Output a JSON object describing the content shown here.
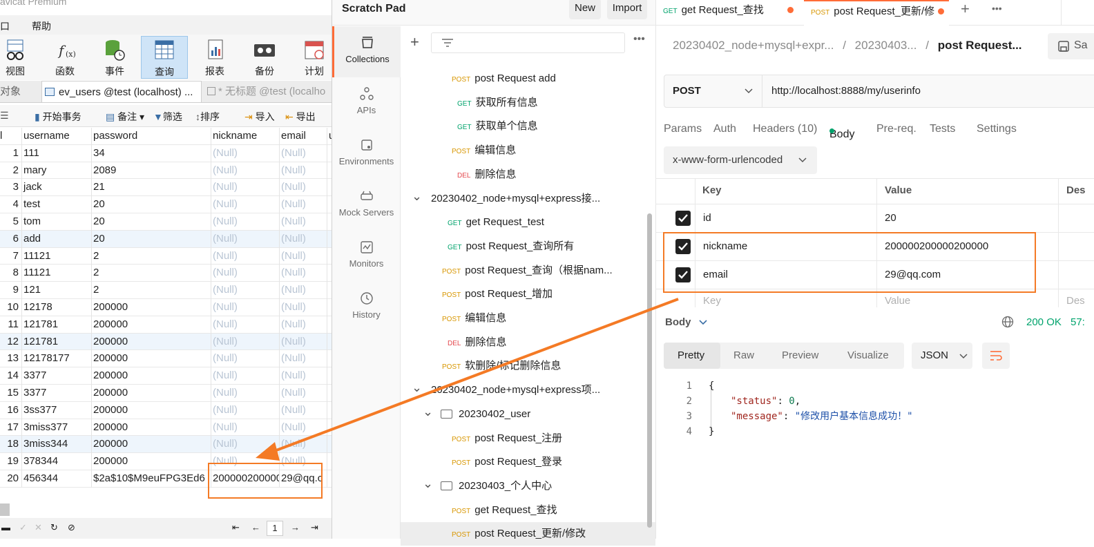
{
  "navicat": {
    "app_title": "avicat Premium",
    "menu": [
      "口",
      "帮助"
    ],
    "toolbar": [
      {
        "label": "视图",
        "icon": "view-icon"
      },
      {
        "label": "函数",
        "icon": "function-icon"
      },
      {
        "label": "事件",
        "icon": "event-icon"
      },
      {
        "label": "查询",
        "icon": "query-icon",
        "active": true
      },
      {
        "label": "报表",
        "icon": "report-icon"
      },
      {
        "label": "备份",
        "icon": "backup-icon"
      },
      {
        "label": "计划",
        "icon": "schedule-icon"
      }
    ],
    "tabs": [
      "对象",
      "ev_users @test (localhost) ...",
      "* 无标题 @test (localho"
    ],
    "actions": [
      "开始事务",
      "备注",
      "筛选",
      "排序",
      "导入",
      "导出"
    ],
    "columns": [
      "l",
      "username",
      "password",
      "nickname",
      "email",
      "u"
    ],
    "rows": [
      {
        "id": "1",
        "username": "111",
        "password": "34",
        "nickname": "(Null)",
        "email": "(Null)"
      },
      {
        "id": "2",
        "username": "mary",
        "password": "2089",
        "nickname": "(Null)",
        "email": "(Null)"
      },
      {
        "id": "3",
        "username": "jack",
        "password": "21",
        "nickname": "(Null)",
        "email": "(Null)"
      },
      {
        "id": "4",
        "username": "test",
        "password": "20",
        "nickname": "(Null)",
        "email": "(Null)"
      },
      {
        "id": "5",
        "username": "tom",
        "password": "20",
        "nickname": "(Null)",
        "email": "(Null)"
      },
      {
        "id": "6",
        "username": "add",
        "password": "20",
        "nickname": "(Null)",
        "email": "(Null)"
      },
      {
        "id": "7",
        "username": "11121",
        "password": "2",
        "nickname": "(Null)",
        "email": "(Null)"
      },
      {
        "id": "8",
        "username": "11121",
        "password": "2",
        "nickname": "(Null)",
        "email": "(Null)"
      },
      {
        "id": "9",
        "username": "121",
        "password": "2",
        "nickname": "(Null)",
        "email": "(Null)"
      },
      {
        "id": "10",
        "username": "12178",
        "password": "200000",
        "nickname": "(Null)",
        "email": "(Null)"
      },
      {
        "id": "11",
        "username": "121781",
        "password": "200000",
        "nickname": "(Null)",
        "email": "(Null)"
      },
      {
        "id": "12",
        "username": "121781",
        "password": "200000",
        "nickname": "(Null)",
        "email": "(Null)"
      },
      {
        "id": "13",
        "username": "12178177",
        "password": "200000",
        "nickname": "(Null)",
        "email": "(Null)"
      },
      {
        "id": "14",
        "username": "3377",
        "password": "200000",
        "nickname": "(Null)",
        "email": "(Null)"
      },
      {
        "id": "15",
        "username": "3377",
        "password": "200000",
        "nickname": "(Null)",
        "email": "(Null)"
      },
      {
        "id": "16",
        "username": "3ss377",
        "password": "200000",
        "nickname": "(Null)",
        "email": "(Null)"
      },
      {
        "id": "17",
        "username": "3miss377",
        "password": "200000",
        "nickname": "(Null)",
        "email": "(Null)"
      },
      {
        "id": "18",
        "username": "3miss344",
        "password": "200000",
        "nickname": "(Null)",
        "email": "(Null)"
      },
      {
        "id": "19",
        "username": "378344",
        "password": "200000",
        "nickname": "(Null)",
        "email": "(Null)"
      },
      {
        "id": "20",
        "username": "456344",
        "password": "$2a$10$M9euFPG3Ed6",
        "nickname": "2000002000002",
        "email": "29@qq.c"
      }
    ],
    "pager": {
      "page": "1"
    }
  },
  "postman": {
    "workspace": "Scratch Pad",
    "new_label": "New",
    "import_label": "Import",
    "rail": [
      {
        "label": "Collections",
        "icon": "collections-icon",
        "active": true
      },
      {
        "label": "APIs",
        "icon": "apis-icon"
      },
      {
        "label": "Environments",
        "icon": "environments-icon"
      },
      {
        "label": "Mock Servers",
        "icon": "mock-servers-icon"
      },
      {
        "label": "Monitors",
        "icon": "monitors-icon"
      },
      {
        "label": "History",
        "icon": "history-icon"
      }
    ],
    "tree": [
      {
        "method": "POST",
        "name": "post Request add",
        "indent": 74
      },
      {
        "method": "GET",
        "name": "获取所有信息",
        "indent": 82
      },
      {
        "method": "GET",
        "name": "获取单个信息",
        "indent": 82
      },
      {
        "method": "POST",
        "name": "编辑信息",
        "indent": 74
      },
      {
        "method": "DEL",
        "name": "删除信息",
        "indent": 82
      },
      {
        "folder": true,
        "chevron": true,
        "name": "20230402_node+mysql+express接...",
        "indent": 44
      },
      {
        "method": "GET",
        "name": "get Request_test",
        "indent": 68
      },
      {
        "method": "GET",
        "name": "post Request_查询所有",
        "indent": 68
      },
      {
        "method": "POST",
        "name": "post Request_查询（根据nam...",
        "indent": 60
      },
      {
        "method": "POST",
        "name": "post Request_增加",
        "indent": 60
      },
      {
        "method": "POST",
        "name": "编辑信息",
        "indent": 60
      },
      {
        "method": "DEL",
        "name": "删除信息",
        "indent": 68
      },
      {
        "method": "POST",
        "name": "软删除/标记删除信息",
        "indent": 60
      },
      {
        "folder": true,
        "chevron": true,
        "name": "20230402_node+mysql+express项...",
        "indent": 44
      },
      {
        "folder": true,
        "chevron": true,
        "icon": true,
        "name": "20230402_user",
        "indent": 60
      },
      {
        "method": "POST",
        "name": "post Request_注册",
        "indent": 74
      },
      {
        "method": "POST",
        "name": "post Request_登录",
        "indent": 74
      },
      {
        "folder": true,
        "chevron": true,
        "icon": true,
        "name": "20230403_个人中心",
        "indent": 60
      },
      {
        "method": "POST",
        "name": "get Request_查找",
        "indent": 74
      },
      {
        "method": "POST",
        "name": "post Request_更新/修改",
        "indent": 74,
        "selected": true
      }
    ],
    "open_tabs": [
      {
        "method": "GET",
        "name": "get Request_查找"
      },
      {
        "method": "POST",
        "name": "post Request_更新/修"
      }
    ],
    "breadcrumb": {
      "a": "20230402_node+mysql+expr...",
      "b": "20230403...",
      "c": "post Request...",
      "sep": "/"
    },
    "save_label": "Sa",
    "method": "POST",
    "url": "http://localhost:8888/my/userinfo",
    "req_tabs": [
      "Params",
      "Auth",
      "Headers (10)",
      "Body",
      "Pre-req.",
      "Tests",
      "Settings"
    ],
    "body_type": "x-www-form-urlencoded",
    "kv_header": {
      "key": "Key",
      "value": "Value",
      "desc": "Des"
    },
    "kv_rows": [
      {
        "key": "id",
        "value": "20"
      },
      {
        "key": "nickname",
        "value": "200000200000200000"
      },
      {
        "key": "email",
        "value": "29@qq.com"
      }
    ],
    "kv_placeholder": {
      "key": "Key",
      "value": "Value",
      "desc": "Des"
    },
    "response": {
      "label": "Body",
      "status": "200 OK",
      "time": "57:"
    },
    "view_tabs": [
      "Pretty",
      "Raw",
      "Preview",
      "Visualize"
    ],
    "format": "JSON",
    "json_lines": [
      "1",
      "2",
      "3",
      "4"
    ],
    "json": {
      "open": "{",
      "k1": "\"status\"",
      "v1": "0",
      "k2": "\"message\"",
      "v2": "\"修改用户基本信息成功！\"",
      "close": "}"
    }
  },
  "colors": {
    "accent": "#ff6c37",
    "annotation": "#f47a25",
    "post": "#d89600",
    "get": "#00a36c",
    "del": "#e5484d"
  }
}
